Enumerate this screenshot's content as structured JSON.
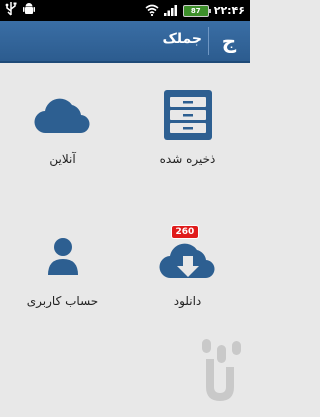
{
  "status_bar": {
    "time": "۲۲:۴۶",
    "battery": "87",
    "icons": [
      "usb-icon",
      "android-debug-icon",
      "wifi-icon",
      "signal-icon",
      "battery-icon"
    ]
  },
  "app_bar": {
    "title": "جملک",
    "logo": "ج"
  },
  "tiles": {
    "saved": {
      "label": "ذخیره شده",
      "icon": "cabinet-icon"
    },
    "online": {
      "label": "آنلاین",
      "icon": "cloud-icon"
    },
    "download": {
      "label": "دانلود",
      "icon": "cloud-download-icon",
      "badge": "260"
    },
    "account": {
      "label": "حساب کاربری",
      "icon": "user-icon"
    }
  },
  "watermark": {
    "text": "ج"
  },
  "colors": {
    "app_bar": "#2f6399",
    "icon": "#2d5f91",
    "badge": "#e01b1b",
    "background": "#e8e8e8"
  }
}
